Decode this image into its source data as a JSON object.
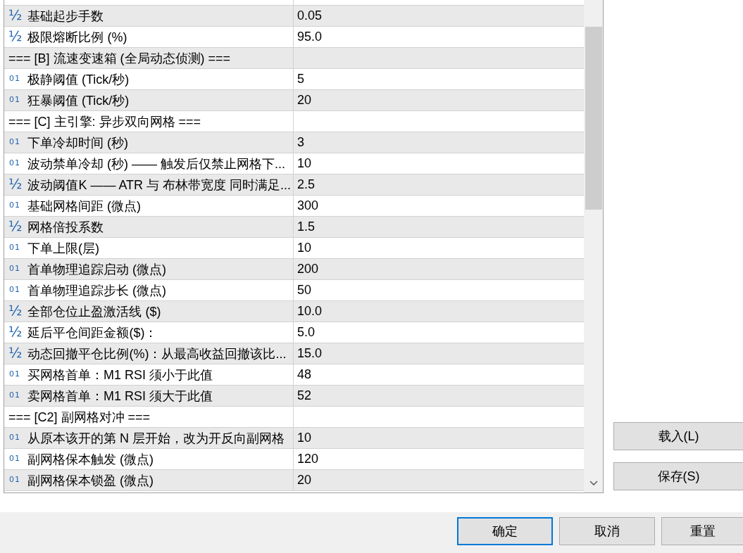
{
  "parameters": {
    "rows": [
      {
        "kind": "double",
        "icon": "½",
        "name": "基础起步手数",
        "value": "0.05"
      },
      {
        "kind": "double",
        "icon": "½",
        "name": "极限熔断比例 (%)",
        "value": "95.0"
      },
      {
        "kind": "section",
        "name": "=== [B] 流速变速箱 (全局动态侦测) ==="
      },
      {
        "kind": "int",
        "icon": "01",
        "name": "极静阈值 (Tick/秒)",
        "value": "5"
      },
      {
        "kind": "int",
        "icon": "01",
        "name": "狂暴阈值 (Tick/秒)",
        "value": "20"
      },
      {
        "kind": "section",
        "name": "=== [C] 主引擎: 异步双向网格 ==="
      },
      {
        "kind": "int",
        "icon": "01",
        "name": "下单冷却时间 (秒)",
        "value": "3"
      },
      {
        "kind": "int",
        "icon": "01",
        "name": "波动禁单冷却 (秒) —— 触发后仅禁止网格下...",
        "value": "10"
      },
      {
        "kind": "double",
        "icon": "½",
        "name": "波动阈值K —— ATR 与 布林带宽度 同时满足...",
        "value": "2.5"
      },
      {
        "kind": "int",
        "icon": "01",
        "name": "基础网格间距 (微点)",
        "value": "300"
      },
      {
        "kind": "double",
        "icon": "½",
        "name": "网格倍投系数",
        "value": "1.5"
      },
      {
        "kind": "int",
        "icon": "01",
        "name": "下单上限(层)",
        "value": "10"
      },
      {
        "kind": "int",
        "icon": "01",
        "name": "首单物理追踪启动 (微点)",
        "value": "200"
      },
      {
        "kind": "int",
        "icon": "01",
        "name": "首单物理追踪步长 (微点)",
        "value": "50"
      },
      {
        "kind": "double",
        "icon": "½",
        "name": "全部仓位止盈激活线 ($)",
        "value": "10.0"
      },
      {
        "kind": "double",
        "icon": "½",
        "name": "延后平仓间距金额($)：",
        "value": "5.0"
      },
      {
        "kind": "double",
        "icon": "½",
        "name": "动态回撤平仓比例(%)：从最高收益回撤该比...",
        "value": "15.0"
      },
      {
        "kind": "int",
        "icon": "01",
        "name": "买网格首单：M1 RSI 须小于此值",
        "value": "48"
      },
      {
        "kind": "int",
        "icon": "01",
        "name": "卖网格首单：M1 RSI 须大于此值",
        "value": "52"
      },
      {
        "kind": "section",
        "name": "=== [C2] 副网格对冲 ==="
      },
      {
        "kind": "int",
        "icon": "01",
        "name": "从原本该开的第 N 层开始，改为开反向副网格",
        "value": "10"
      },
      {
        "kind": "int",
        "icon": "01",
        "name": "副网格保本触发 (微点)",
        "value": "120"
      },
      {
        "kind": "int",
        "icon": "01",
        "name": "副网格保本锁盈 (微点)",
        "value": "20"
      }
    ]
  },
  "side_buttons": [
    {
      "label": "载入(L)"
    },
    {
      "label": "保存(S)"
    }
  ],
  "dialog_buttons": [
    {
      "label": "确定",
      "default": true
    },
    {
      "label": "取消",
      "default": false
    },
    {
      "label": "重置",
      "default": false
    }
  ]
}
